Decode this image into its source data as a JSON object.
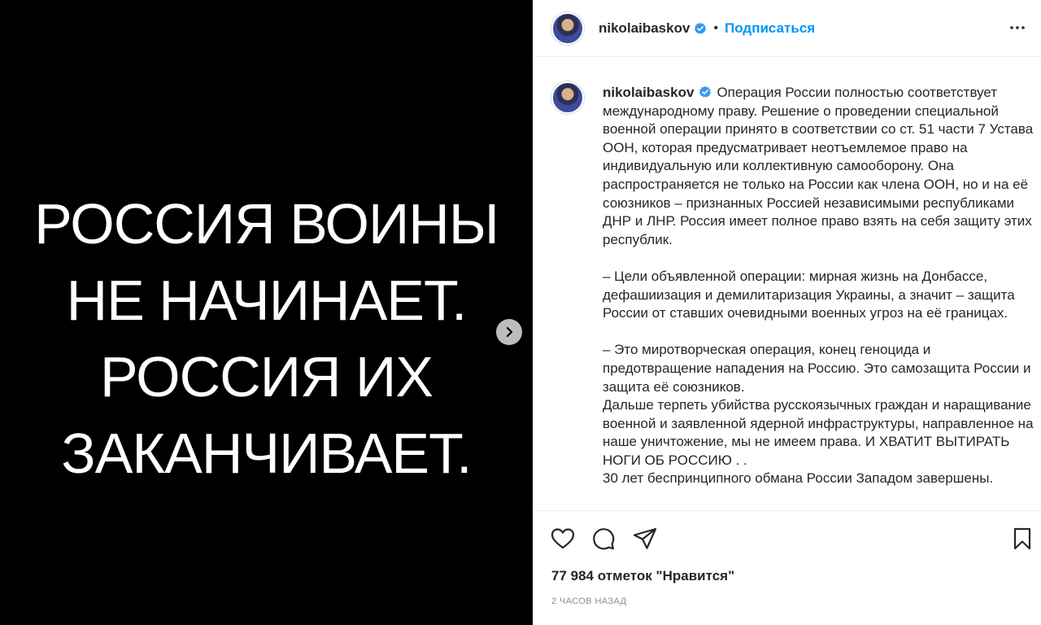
{
  "media": {
    "slide_text_lines": [
      "РОССИЯ ВОИНЫ",
      "НЕ НАЧИНАЕТ.",
      "РОССИЯ ИХ",
      "ЗАКАНЧИВАЕТ."
    ],
    "background_color": "#000000",
    "text_color": "#ffffff",
    "next_icon": "chevron-right-icon"
  },
  "header": {
    "username": "nikolaibaskov",
    "separator": "•",
    "follow_label": "Подписаться",
    "more_icon": "more-horizontal-icon",
    "accent_color": "#0095f6"
  },
  "caption": {
    "username": "nikolaibaskov",
    "paragraphs": [
      "Операция России полностью соответствует международному праву. Решение о проведении специальной военной операции принято в соответствии со ст. 51 части 7 Устава ООН, которая предусматривает неотъемлемое право на индивидуальную или коллективную самооборону. Она распространяется не только на России как члена ООН, но и на её союзников – признанных Россией независимыми республиками ДНР и ЛНР. Россия имеет полное право взять на себя защиту этих республик.",
      "– Цели объявленной операции: мирная жизнь на Донбассе, дефашиизация и демилитаризация Украины, а значит – защита России от ставших очевидными военных угроз на её границах.",
      "– Это миротворческая операция, конец геноцида и предотвращение нападения на Россию. Это самозащита России и защита её союзников.",
      "Дальше терпеть убийства русскоязычных граждан и наращивание военной и заявленной ядерной инфраструктуры, направленное на наше уничтожение, мы не имеем права. И ХВАТИТ ВЫТИРАТЬ НОГИ ОБ РОССИЮ . .",
      "30 лет беспринципного обмана России Западом завершены."
    ]
  },
  "actions": {
    "like_icon": "heart-icon",
    "comment_icon": "comment-icon",
    "share_icon": "paper-plane-icon",
    "save_icon": "bookmark-icon",
    "likes_text": "77 984 отметок \"Нравится\"",
    "timestamp": "2 часов назад"
  }
}
